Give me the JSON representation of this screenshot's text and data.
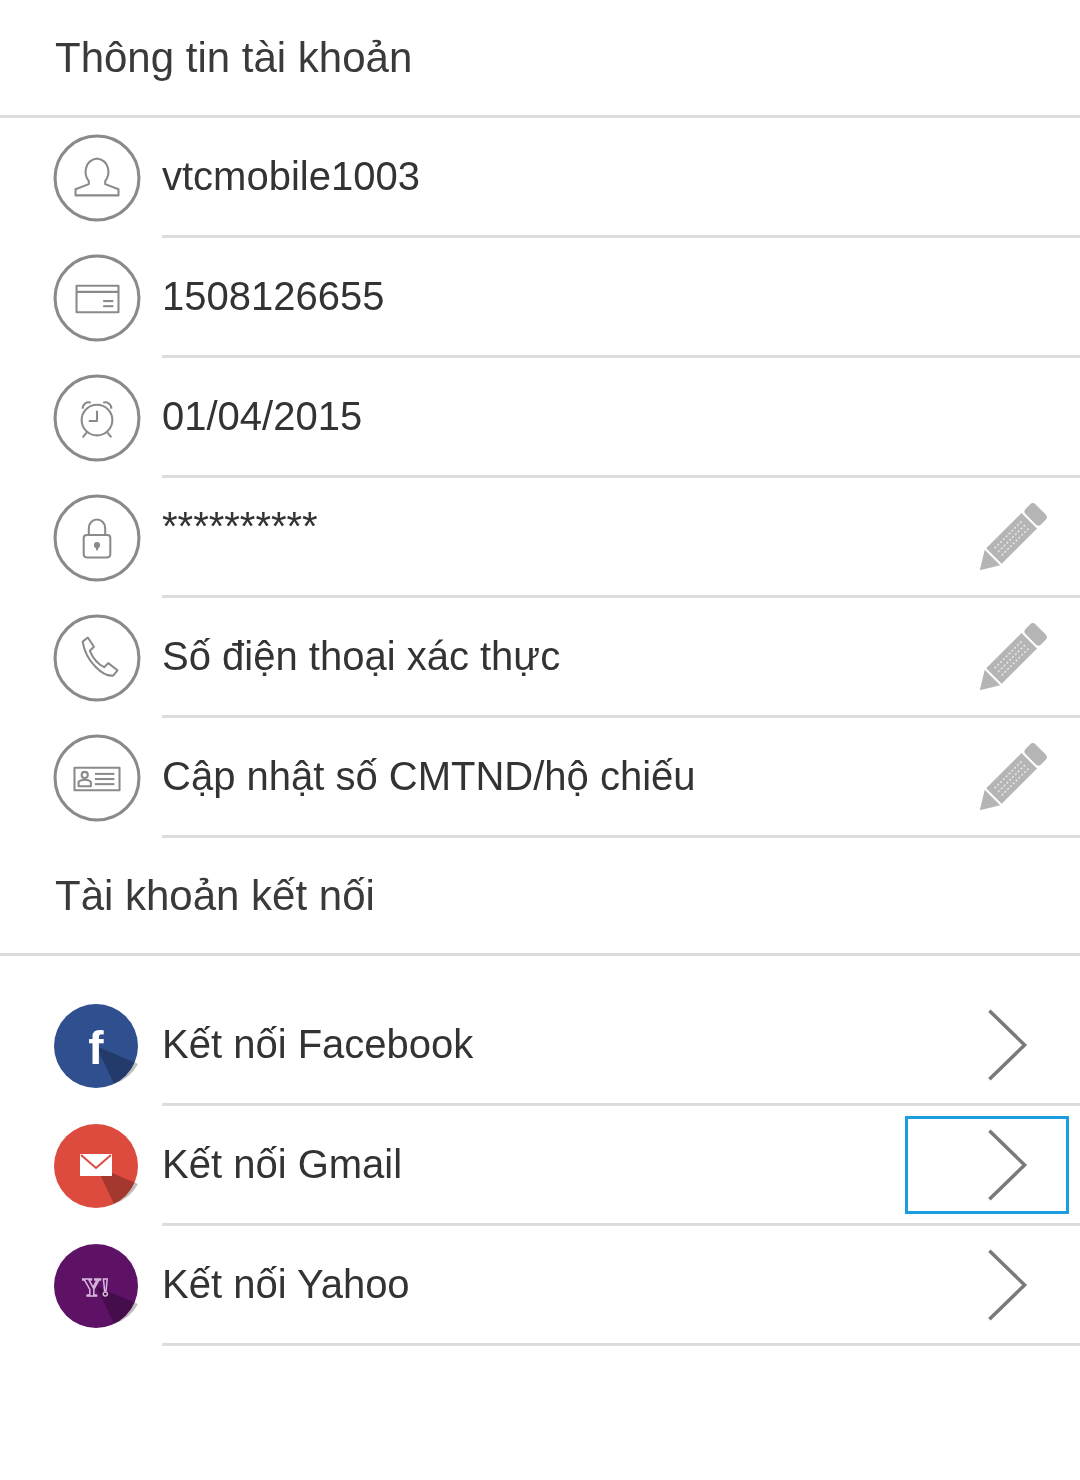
{
  "account_section": {
    "title": "Thông tin tài khoản",
    "rows": [
      {
        "kind": "user",
        "text": "vtcmobile1003",
        "editable": false
      },
      {
        "kind": "card",
        "text": "1508126655",
        "editable": false
      },
      {
        "kind": "clock",
        "text": "01/04/2015",
        "editable": false
      },
      {
        "kind": "lock",
        "text": "**********",
        "editable": true
      },
      {
        "kind": "phone",
        "text": "Số điện thoại xác thực",
        "editable": true
      },
      {
        "kind": "idcard",
        "text": "Cập nhật số CMTND/hộ chiếu",
        "editable": true
      }
    ]
  },
  "linked_section": {
    "title": "Tài khoản kết nối",
    "rows": [
      {
        "kind": "facebook",
        "glyph": "f",
        "color": "#2f4f8f",
        "label": "Kết nối Facebook",
        "focused": false
      },
      {
        "kind": "gmail",
        "color": "#dd4b3e",
        "label": "Kết nối Gmail",
        "focused": true
      },
      {
        "kind": "yahoo",
        "glyph": "Y!",
        "color": "#5e1266",
        "label": "Kết nối Yahoo",
        "focused": false
      }
    ]
  }
}
